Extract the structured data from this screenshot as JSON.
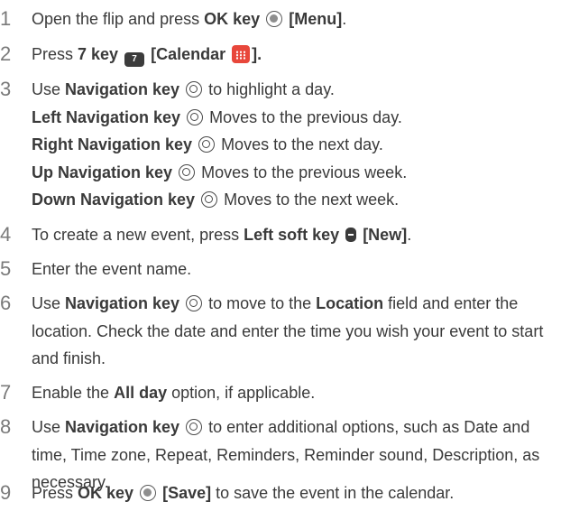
{
  "steps": [
    {
      "num": "1",
      "lines": [
        {
          "a": "Open the flip and press ",
          "b": "OK key",
          "c": "[Menu]",
          "d": "."
        }
      ]
    },
    {
      "num": "2",
      "lines": [
        {
          "a": "Press ",
          "b": "7 key",
          "c": "[Calendar",
          "d": "].",
          "key_label": "7"
        }
      ]
    },
    {
      "num": "3",
      "lines": [
        {
          "a": "Use ",
          "b": "Navigation key",
          "c": "to highlight a day."
        },
        {
          "b": "Left Navigation key",
          "c": "Moves to the previous day."
        },
        {
          "b": "Right Navigation key",
          "c": "Moves to the next day."
        },
        {
          "b": "Up Navigation key",
          "c": "Moves to the previous week."
        },
        {
          "b": "Down Navigation key",
          "c": "Moves to the next week."
        }
      ]
    },
    {
      "num": "4",
      "lines": [
        {
          "a": "To create a new event, press ",
          "b": "Left soft key",
          "c": "[New]",
          "d": "."
        }
      ]
    },
    {
      "num": "5",
      "lines": [
        {
          "a": "Enter the event name."
        }
      ]
    },
    {
      "num": "6",
      "lines": [
        {
          "a": "Use ",
          "b": "Navigation key",
          "c": "to move to the ",
          "d": "Location",
          "e": " field and enter the location. Check the date and enter the time you wish your event to start and finish."
        }
      ]
    },
    {
      "num": "7",
      "lines": [
        {
          "a": "Enable the ",
          "b": "All day",
          "c": " option, if applicable."
        }
      ]
    },
    {
      "num": "8",
      "lines": [
        {
          "a": "Use ",
          "b": "Navigation key",
          "c": "to enter additional options, such as Date and time, Time zone, Repeat, Reminders, Reminder sound, Description, as necessary."
        }
      ]
    },
    {
      "num": "9",
      "lines": [
        {
          "a": "Press ",
          "b": "OK key",
          "c": "[Save]",
          "d": " to save the event in the calendar."
        }
      ]
    }
  ],
  "icons": {
    "ok": "ok-key-icon",
    "nav": "navigation-key-icon",
    "key7": "seven-key-icon",
    "calendar": "calendar-app-icon",
    "soft": "left-soft-key-icon"
  },
  "colors": {
    "text": "#3a3a3a",
    "step_number": "#7a7a7a",
    "calendar_icon": "#e8473b",
    "key_icon": "#3c3c3c"
  }
}
